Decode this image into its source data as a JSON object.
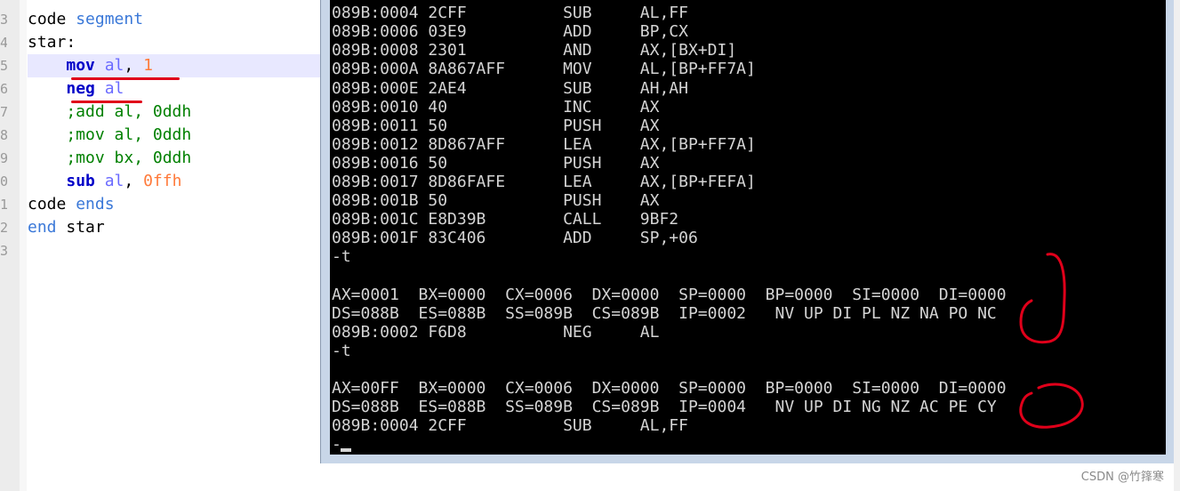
{
  "editor": {
    "line_numbers": [
      "3",
      "4",
      "5",
      "6",
      "7",
      "8",
      "9",
      "0",
      "1",
      "2",
      "3"
    ],
    "lines": [
      [
        {
          "t": "code ",
          "c": "plain"
        },
        {
          "t": "segment",
          "c": "kw"
        }
      ],
      [
        {
          "t": "star:",
          "c": "plain"
        }
      ],
      [
        {
          "t": "    ",
          "c": "plain"
        },
        {
          "t": "mov",
          "c": "instr"
        },
        {
          "t": " ",
          "c": "plain"
        },
        {
          "t": "al",
          "c": "reg"
        },
        {
          "t": ", ",
          "c": "plain"
        },
        {
          "t": "1",
          "c": "num"
        }
      ],
      [
        {
          "t": "    ",
          "c": "plain"
        },
        {
          "t": "neg",
          "c": "instr"
        },
        {
          "t": " ",
          "c": "plain"
        },
        {
          "t": "al",
          "c": "reg"
        }
      ],
      [
        {
          "t": "    ;add al, 0ddh",
          "c": "comment"
        }
      ],
      [
        {
          "t": "    ;mov al, 0ddh",
          "c": "comment"
        }
      ],
      [
        {
          "t": "    ;mov bx, 0ddh",
          "c": "comment"
        }
      ],
      [
        {
          "t": "    ",
          "c": "plain"
        },
        {
          "t": "sub",
          "c": "instr"
        },
        {
          "t": " ",
          "c": "plain"
        },
        {
          "t": "al",
          "c": "reg"
        },
        {
          "t": ", ",
          "c": "plain"
        },
        {
          "t": "0ffh",
          "c": "num"
        }
      ],
      [
        {
          "t": "code ",
          "c": "plain"
        },
        {
          "t": "ends",
          "c": "kw"
        }
      ],
      [
        {
          "t": "end",
          "c": "kw"
        },
        {
          "t": " star",
          "c": "plain"
        }
      ],
      []
    ]
  },
  "console": {
    "lines": [
      "089B:0002 F6D8          NEG     AL",
      "089B:0004 2CFF          SUB     AL,FF",
      "089B:0006 03E9          ADD     BP,CX",
      "089B:0008 2301          AND     AX,[BX+DI]",
      "089B:000A 8A867AFF      MOV     AL,[BP+FF7A]",
      "089B:000E 2AE4          SUB     AH,AH",
      "089B:0010 40            INC     AX",
      "089B:0011 50            PUSH    AX",
      "089B:0012 8D867AFF      LEA     AX,[BP+FF7A]",
      "089B:0016 50            PUSH    AX",
      "089B:0017 8D86FAFE      LEA     AX,[BP+FEFA]",
      "089B:001B 50            PUSH    AX",
      "089B:001C E8D39B        CALL    9BF2",
      "089B:001F 83C406        ADD     SP,+06",
      "-t",
      "",
      "AX=0001  BX=0000  CX=0006  DX=0000  SP=0000  BP=0000  SI=0000  DI=0000",
      "DS=088B  ES=088B  SS=089B  CS=089B  IP=0002   NV UP DI PL NZ NA PO NC",
      "089B:0002 F6D8          NEG     AL",
      "-t",
      "",
      "AX=00FF  BX=0000  CX=0006  DX=0000  SP=0000  BP=0000  SI=0000  DI=0000",
      "DS=088B  ES=088B  SS=089B  CS=089B  IP=0004   NV UP DI NG NZ AC PE CY",
      "089B:0004 2CFF          SUB     AL,FF",
      "-"
    ]
  },
  "watermark": "CSDN @竹箨寒",
  "colors": {
    "annotation_red": "#e0001a",
    "console_bg": "#000000",
    "console_text": "#d4d4d4"
  }
}
